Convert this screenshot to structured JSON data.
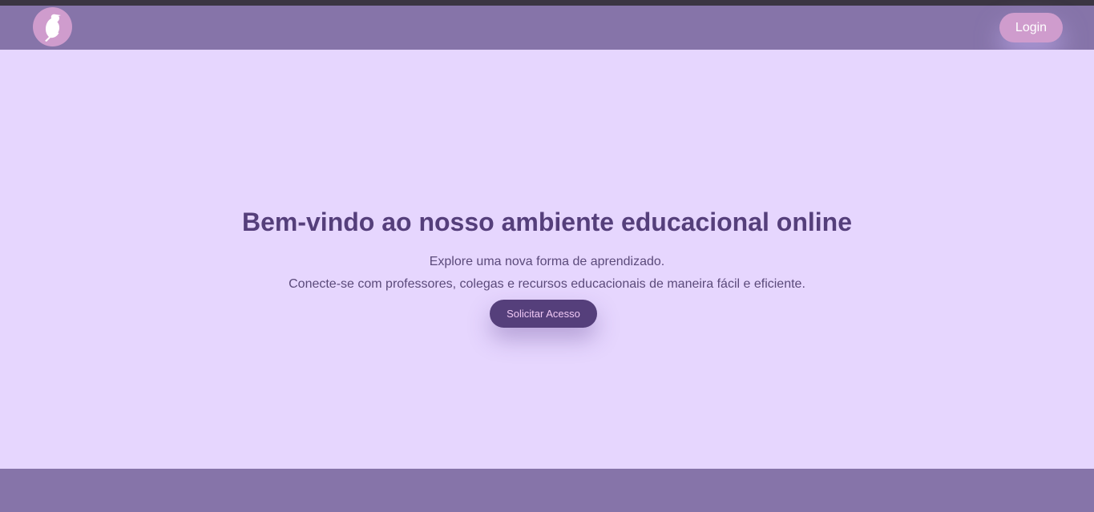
{
  "header": {
    "logo_icon": "bird-icon",
    "login_label": "Login"
  },
  "hero": {
    "title": "Bem-vindo ao nosso ambiente educacional online",
    "line1": "Explore uma nova forma de aprendizado.",
    "line2": "Conecte-se com professores, colegas e recursos educacionais de maneira fácil e eficiente.",
    "cta_label": "Solicitar Acesso"
  },
  "colors": {
    "header_bg": "#8674a9",
    "page_bg": "#e6d6fe",
    "accent_pink": "#cf9ccd",
    "accent_dark": "#553f7b"
  }
}
